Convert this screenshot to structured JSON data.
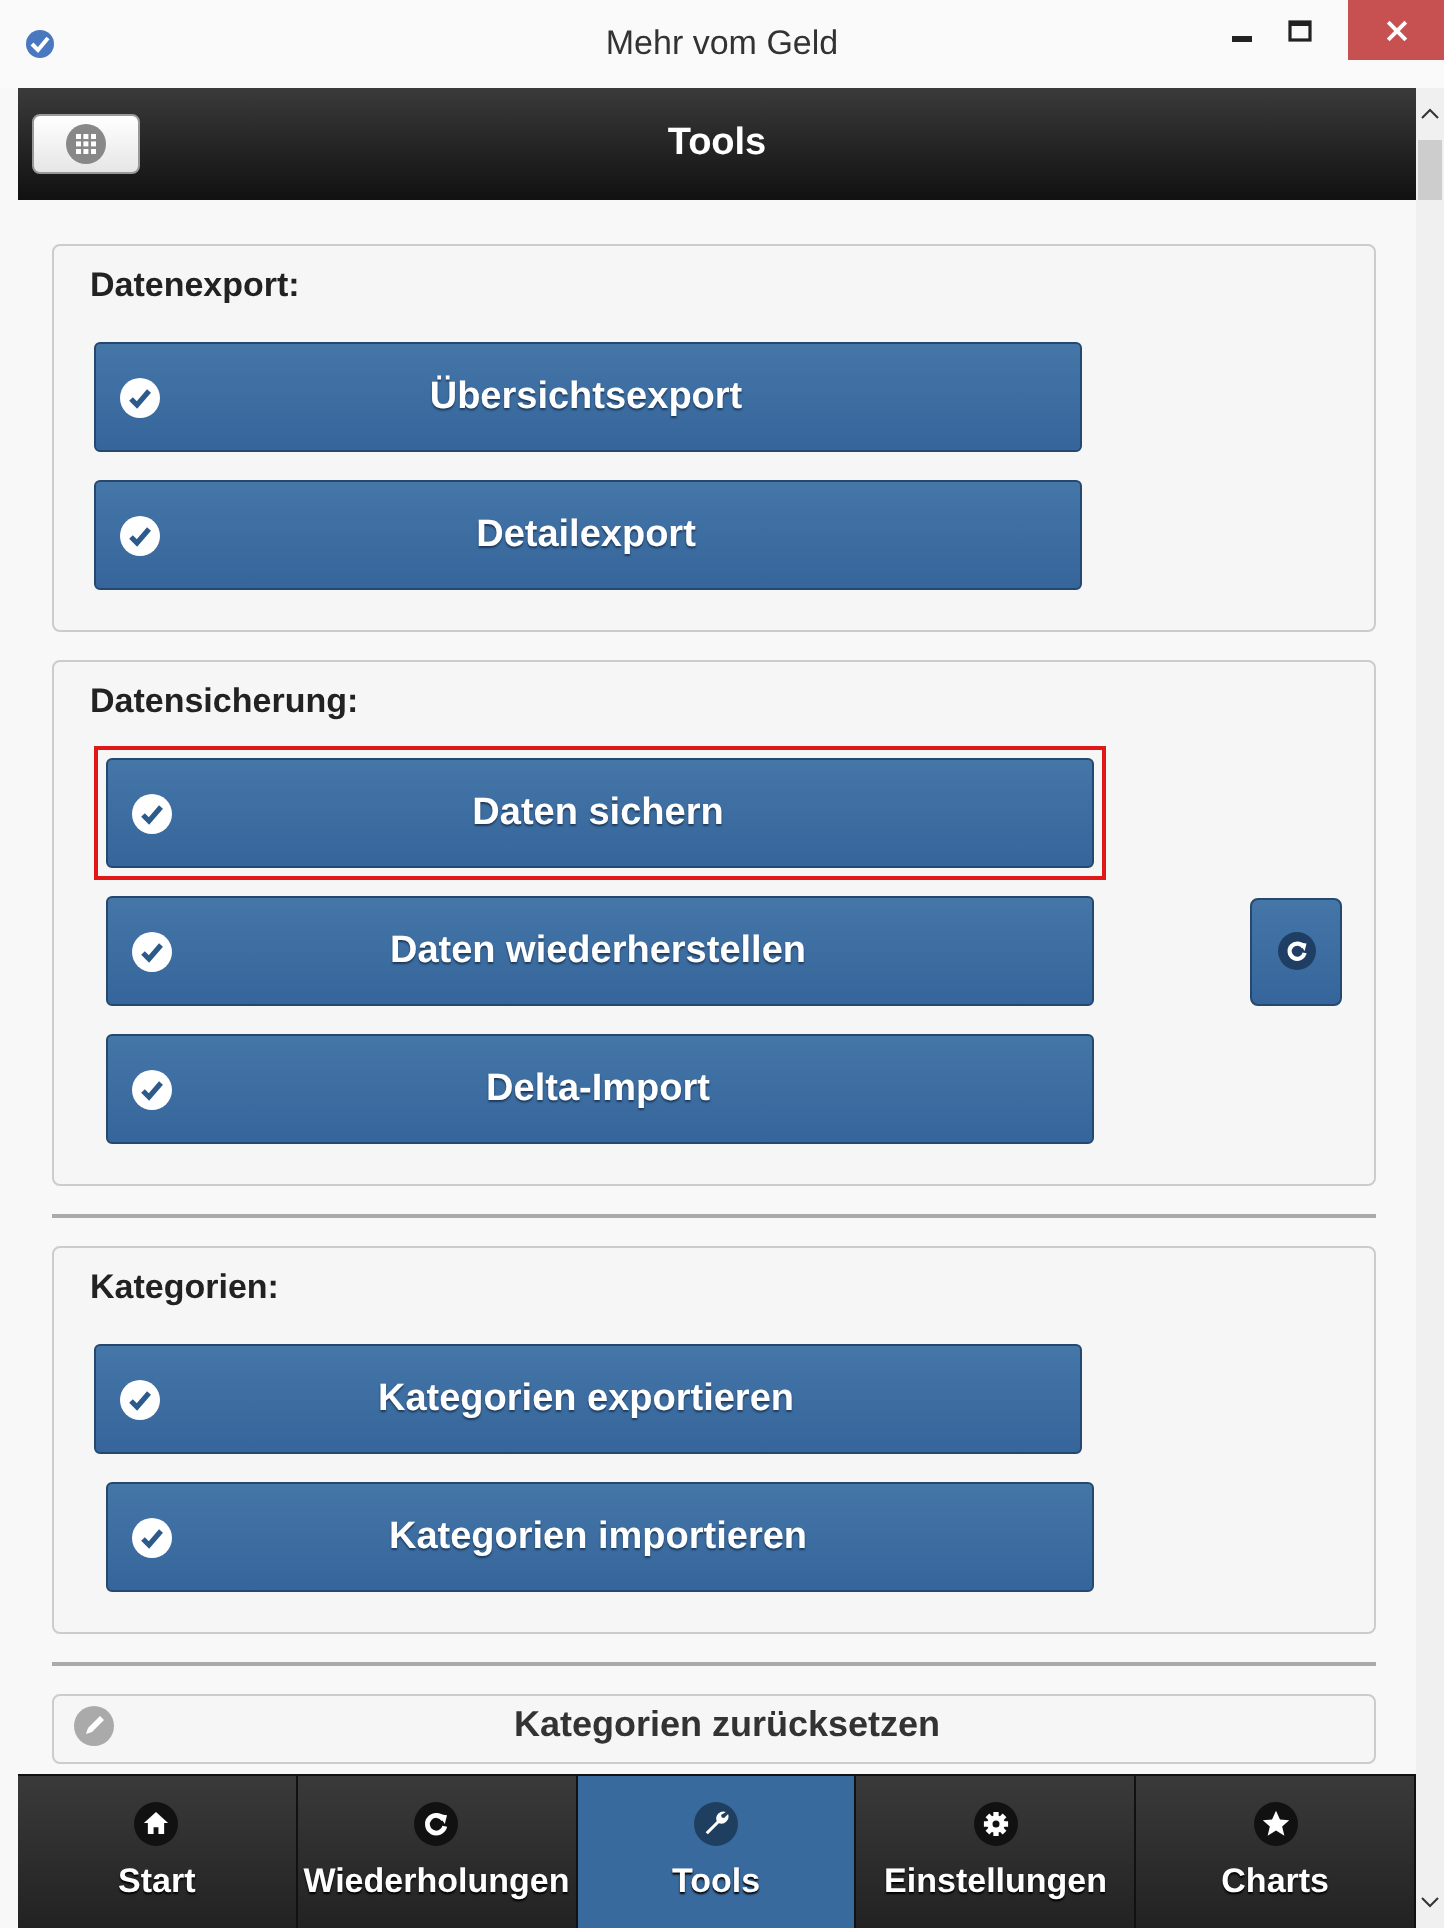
{
  "window": {
    "title": "Mehr vom Geld"
  },
  "header": {
    "title": "Tools"
  },
  "sections": [
    {
      "title": "Datenexport:",
      "buttons": [
        {
          "label": "Übersichtsexport",
          "highlighted": false,
          "indented": false,
          "side_button": false
        },
        {
          "label": "Detailexport",
          "highlighted": false,
          "indented": false,
          "side_button": false
        }
      ]
    },
    {
      "title": "Datensicherung:",
      "buttons": [
        {
          "label": "Daten sichern",
          "highlighted": true,
          "indented": true,
          "side_button": false
        },
        {
          "label": "Daten wiederherstellen",
          "highlighted": false,
          "indented": true,
          "side_button": true
        },
        {
          "label": "Delta-Import",
          "highlighted": false,
          "indented": true,
          "side_button": false
        }
      ]
    },
    {
      "title": "Kategorien:",
      "buttons": [
        {
          "label": "Kategorien exportieren",
          "highlighted": false,
          "indented": false,
          "side_button": false
        },
        {
          "label": "Kategorien importieren",
          "highlighted": false,
          "indented": true,
          "side_button": false
        }
      ]
    }
  ],
  "reset_button": {
    "label": "Kategorien zurücksetzen"
  },
  "tabs": [
    {
      "label": "Start",
      "selected": false
    },
    {
      "label": "Wiederholungen",
      "selected": false
    },
    {
      "label": "Tools",
      "selected": true
    },
    {
      "label": "Einstellungen",
      "selected": false
    },
    {
      "label": "Charts",
      "selected": false
    }
  ]
}
